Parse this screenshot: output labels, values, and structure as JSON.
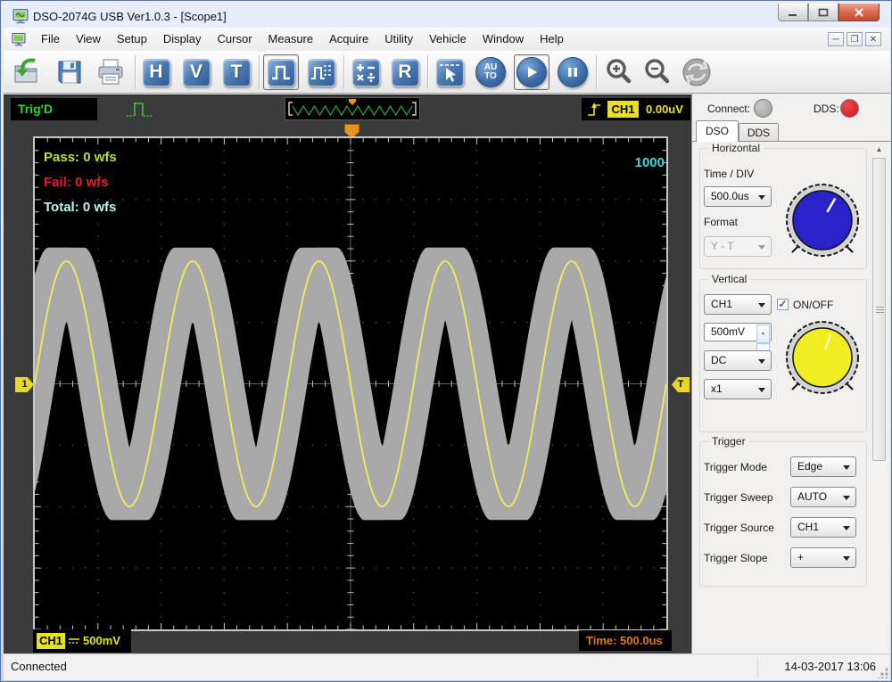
{
  "window": {
    "title": "DSO-2074G USB Ver1.0.3 - [Scope1]"
  },
  "menu": {
    "items": [
      "File",
      "View",
      "Setup",
      "Display",
      "Cursor",
      "Measure",
      "Acquire",
      "Utility",
      "Vehicle",
      "Window",
      "Help"
    ]
  },
  "toolbar": {
    "h_label": "H",
    "v_label": "V",
    "t_label": "T",
    "r_label": "R",
    "auto_label": "AUTO"
  },
  "strip": {
    "trigger_status": "Trig'D",
    "channel_badge": "CH1",
    "channel_value": "0.00uV"
  },
  "scope": {
    "pass": "Pass: 0 wfs",
    "fail": "Fail: 0 wfs",
    "total": "Total: 0 wfs",
    "count": "1000",
    "left_marker": "1",
    "right_marker": "T",
    "channel_badge": "CH1",
    "channel_scale": "500mV",
    "time_label": "Time: 500.0us"
  },
  "panel": {
    "connect_label": "Connect:",
    "dds_label": "DDS:",
    "tabs": [
      "DSO",
      "DDS"
    ],
    "horizontal": {
      "title": "Horizontal",
      "time_div_label": "Time / DIV",
      "time_div_value": "500.0us",
      "format_label": "Format",
      "format_value": "Y - T"
    },
    "vertical": {
      "title": "Vertical",
      "channel_value": "CH1",
      "onoff_label": "ON/OFF",
      "volts_value": "500mV",
      "coupling_value": "DC",
      "probe_value": "x1"
    },
    "trigger": {
      "title": "Trigger",
      "rows": [
        {
          "label": "Trigger Mode",
          "value": "Edge"
        },
        {
          "label": "Trigger Sweep",
          "value": "AUTO"
        },
        {
          "label": "Trigger Source",
          "value": "CH1"
        },
        {
          "label": "Trigger Slope",
          "value": "+"
        }
      ]
    }
  },
  "statusbar": {
    "status": "Connected",
    "datetime": "14-03-2017  13:06"
  },
  "chart_data": {
    "type": "line",
    "title": "CH1 sine waveform with pass/fail mask band",
    "xlabel": "time, 500.0us per division",
    "ylabel": "CH1 voltage, 500mV per division",
    "grid": {
      "cols": 10,
      "rows": 8
    },
    "trace": {
      "shape": "sine",
      "amplitude_div": 2.0,
      "period_div": 2.0,
      "peak_at_div": 0.5,
      "color": "#f0ee58"
    },
    "mask": {
      "expand_x_div": 0.28,
      "expand_y_div": 0.22,
      "color": "#a9a9a9"
    },
    "annotations": {
      "pass": "Pass: 0 wfs",
      "fail": "Fail: 0 wfs",
      "total": "Total: 0 wfs",
      "acquisitions": "1000"
    }
  }
}
